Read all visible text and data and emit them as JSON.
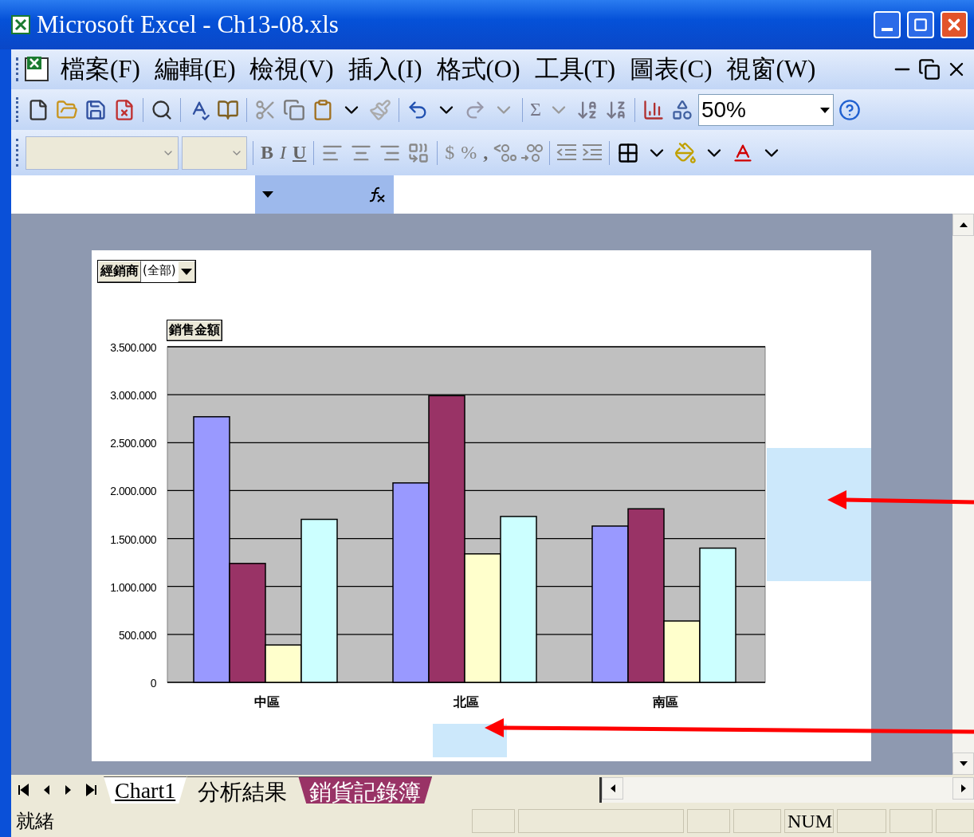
{
  "window": {
    "title": "Microsoft Excel - Ch13-08.xls"
  },
  "menu": [
    {
      "label": "檔案(F)"
    },
    {
      "label": "編輯(E)"
    },
    {
      "label": "檢視(V)"
    },
    {
      "label": "插入(I)"
    },
    {
      "label": "格式(O)"
    },
    {
      "label": "工具(T)"
    },
    {
      "label": "圖表(C)"
    },
    {
      "label": "視窗(W)"
    }
  ],
  "standard_toolbar": {
    "autosum": "Σ",
    "zoom": "50%"
  },
  "formatting_toolbar": {
    "bold": "B",
    "italic": "I",
    "underline": "U",
    "currency": "$",
    "percent": "%",
    "comma": ","
  },
  "chart": {
    "page_field": {
      "label": "經銷商",
      "value": "(全部)"
    },
    "data_field": "銷售金額",
    "chart_data": {
      "type": "bar",
      "grid": true,
      "categories": [
        "中區",
        "北區",
        "南區"
      ],
      "ylim": [
        0,
        3500000
      ],
      "yticks": [
        {
          "value": 0,
          "label": "0"
        },
        {
          "value": 500000,
          "label": "500.000"
        },
        {
          "value": 1000000,
          "label": "1.000.000"
        },
        {
          "value": 1500000,
          "label": "1.500.000"
        },
        {
          "value": 2000000,
          "label": "2.000.000"
        },
        {
          "value": 2500000,
          "label": "2.500.000"
        },
        {
          "value": 3000000,
          "label": "3.000.000"
        },
        {
          "value": 3500000,
          "label": "3.500.000"
        }
      ],
      "series": [
        {
          "color": "#9999ff",
          "values": [
            2770000,
            2080000,
            1630000
          ]
        },
        {
          "color": "#993366",
          "values": [
            1240000,
            2990000,
            1810000
          ]
        },
        {
          "color": "#ffffcc",
          "values": [
            390000,
            1340000,
            640000
          ]
        },
        {
          "color": "#ccffff",
          "values": [
            1700000,
            1730000,
            1400000
          ]
        }
      ]
    }
  },
  "sheet_tabs": [
    {
      "label": "Chart1",
      "selected": true
    },
    {
      "label": "分析結果",
      "selected": false
    },
    {
      "label": "銷貨記錄簿",
      "selected": false,
      "color": "#993366"
    }
  ],
  "status_bar": {
    "text": "就緒",
    "indicators": [
      "NUM"
    ]
  }
}
